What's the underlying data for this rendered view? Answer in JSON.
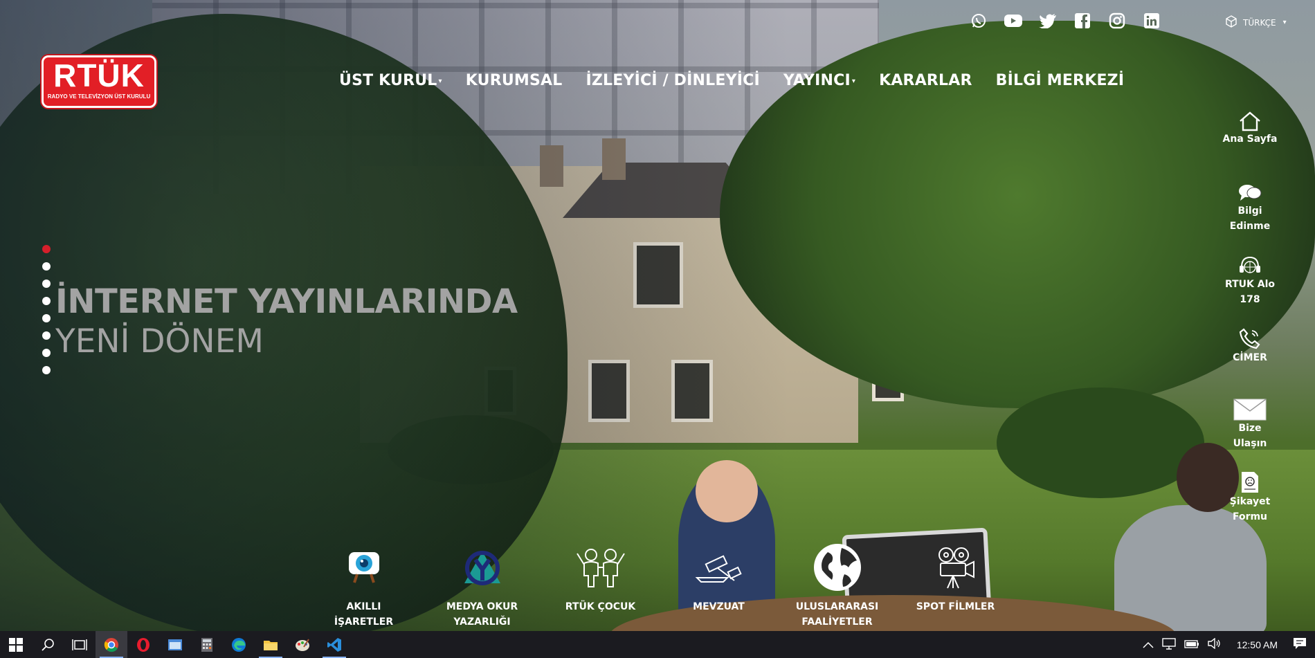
{
  "brand": {
    "logo_text": "RTÜK",
    "logo_subtitle": "RADYO VE TELEVİZYON ÜST KURULU",
    "accent": "#e21f26"
  },
  "social": [
    {
      "icon": "whatsapp-icon"
    },
    {
      "icon": "youtube-icon"
    },
    {
      "icon": "twitter-icon"
    },
    {
      "icon": "facebook-icon"
    },
    {
      "icon": "instagram-icon"
    },
    {
      "icon": "linkedin-icon"
    }
  ],
  "language": {
    "label": "TÜRKÇE"
  },
  "nav": [
    {
      "label": "ÜST KURUL",
      "has_dropdown": true
    },
    {
      "label": "KURUMSAL",
      "has_dropdown": false
    },
    {
      "label": "İZLEYİCİ / DİNLEYİCİ",
      "has_dropdown": false
    },
    {
      "label": "YAYINCI",
      "has_dropdown": true
    },
    {
      "label": "KARARLAR",
      "has_dropdown": false
    },
    {
      "label": "BİLGİ MERKEZİ",
      "has_dropdown": false
    }
  ],
  "slider": {
    "line1": "İNTERNET YAYINLARINDA",
    "line2": "YENİ DÖNEM",
    "dot_count": 8,
    "active_index": 0
  },
  "quick_menu": [
    {
      "label": "Ana Sayfa",
      "icon": "home-icon"
    },
    {
      "label": "Bilgi Edinme",
      "icon": "chat-bubbles-icon"
    },
    {
      "label": "RTUK Alo 178",
      "icon": "headset-icon"
    },
    {
      "label": "CİMER",
      "icon": "phone-icon"
    },
    {
      "label": "Bize Ulaşın",
      "icon": "envelope-icon"
    },
    {
      "label": "Şikayet Formu",
      "icon": "complaint-form-icon"
    }
  ],
  "shortcuts": [
    {
      "label_line1": "AKILLI",
      "label_line2": "İŞARETLER",
      "icon": "smart-signs-icon"
    },
    {
      "label_line1": "MEDYA OKUR",
      "label_line2": "YAZARLIĞI",
      "icon": "media-literacy-icon"
    },
    {
      "label_line1": "RTÜK ÇOCUK",
      "label_line2": "",
      "icon": "children-icon"
    },
    {
      "label_line1": "MEVZUAT",
      "label_line2": "",
      "icon": "legislation-icon"
    },
    {
      "label_line1": "ULUSLARARASI",
      "label_line2": "FAALİYETLER",
      "icon": "globe-icon"
    },
    {
      "label_line1": "SPOT FİLMLER",
      "label_line2": "",
      "icon": "film-camera-icon"
    }
  ],
  "taskbar": {
    "apps": [
      {
        "icon": "windows-start-icon"
      },
      {
        "icon": "search-icon"
      },
      {
        "icon": "task-view-icon"
      },
      {
        "icon": "chrome-icon"
      },
      {
        "icon": "opera-icon"
      },
      {
        "icon": "app-window-icon"
      },
      {
        "icon": "calculator-icon"
      },
      {
        "icon": "edge-icon"
      },
      {
        "icon": "file-explorer-icon"
      },
      {
        "icon": "paint-icon"
      },
      {
        "icon": "vscode-icon"
      }
    ],
    "clock": "12:50 AM"
  }
}
